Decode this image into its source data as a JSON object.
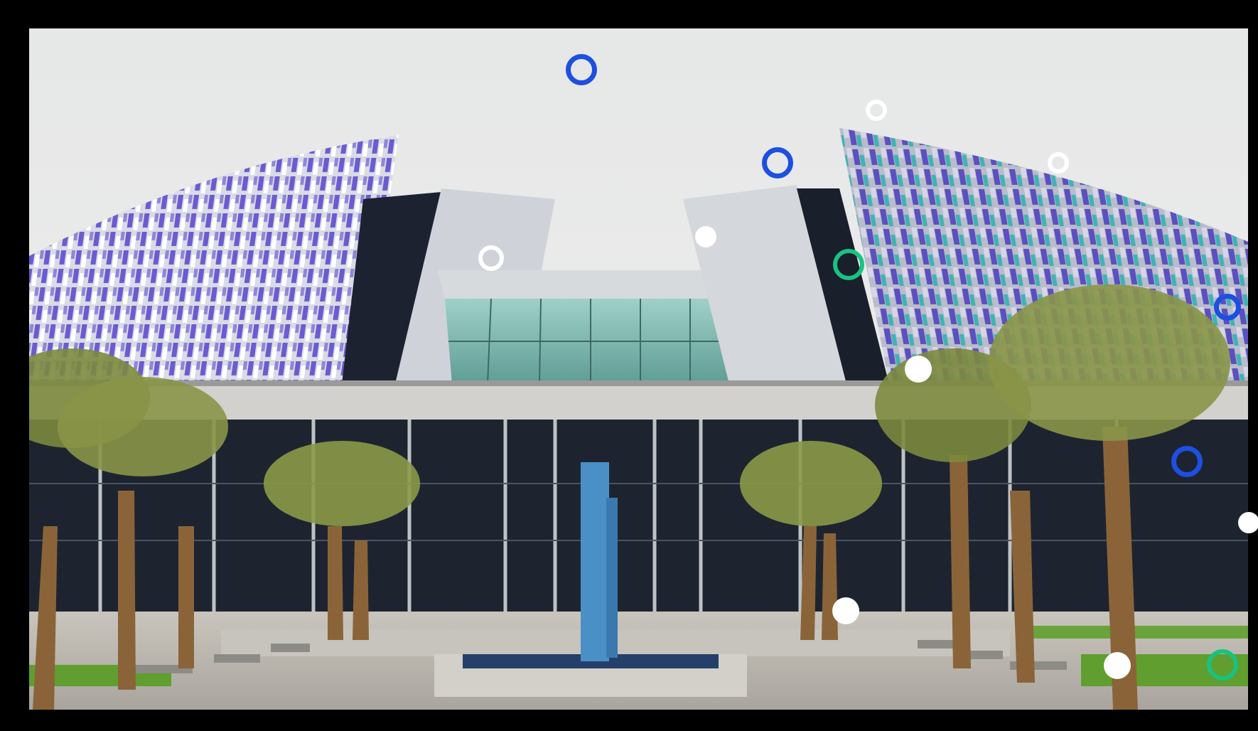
{
  "scene": {
    "description_kind": "photo",
    "colors": {
      "sky": "#e9eaea",
      "facade_purple": "#6a5cd0",
      "facade_teal": "#3fb3b3",
      "glass": "#1d2430",
      "pavement": "#b9b5ae",
      "grass": "#5f9e2f",
      "palm_trunk": "#8a6438",
      "palm_leaf": "#7c8a3e",
      "fountain": "#4b8fc7"
    }
  },
  "markers": {
    "colors": {
      "blue": "#1d4fe0",
      "green": "#19c27f",
      "white": "#ffffff"
    },
    "items": [
      {
        "name": "blue-ring-marker",
        "style": "ring-blue"
      },
      {
        "name": "blue-ring-marker",
        "style": "ring-blue"
      },
      {
        "name": "blue-ring-marker",
        "style": "ring-blue"
      },
      {
        "name": "blue-ring-marker",
        "style": "ring-blue"
      },
      {
        "name": "green-ring-marker",
        "style": "ring-green"
      },
      {
        "name": "green-ring-marker",
        "style": "ring-green"
      },
      {
        "name": "white-ring-marker",
        "style": "ring-white"
      },
      {
        "name": "white-ring-marker",
        "style": "ring-white"
      },
      {
        "name": "white-ring-marker",
        "style": "ring-white"
      },
      {
        "name": "white-dot-marker",
        "style": "dot-white"
      },
      {
        "name": "white-dot-marker",
        "style": "dot-white"
      },
      {
        "name": "white-dot-marker",
        "style": "dot-white"
      },
      {
        "name": "white-dot-marker",
        "style": "dot-white"
      },
      {
        "name": "white-dot-marker",
        "style": "dot-white"
      }
    ]
  }
}
